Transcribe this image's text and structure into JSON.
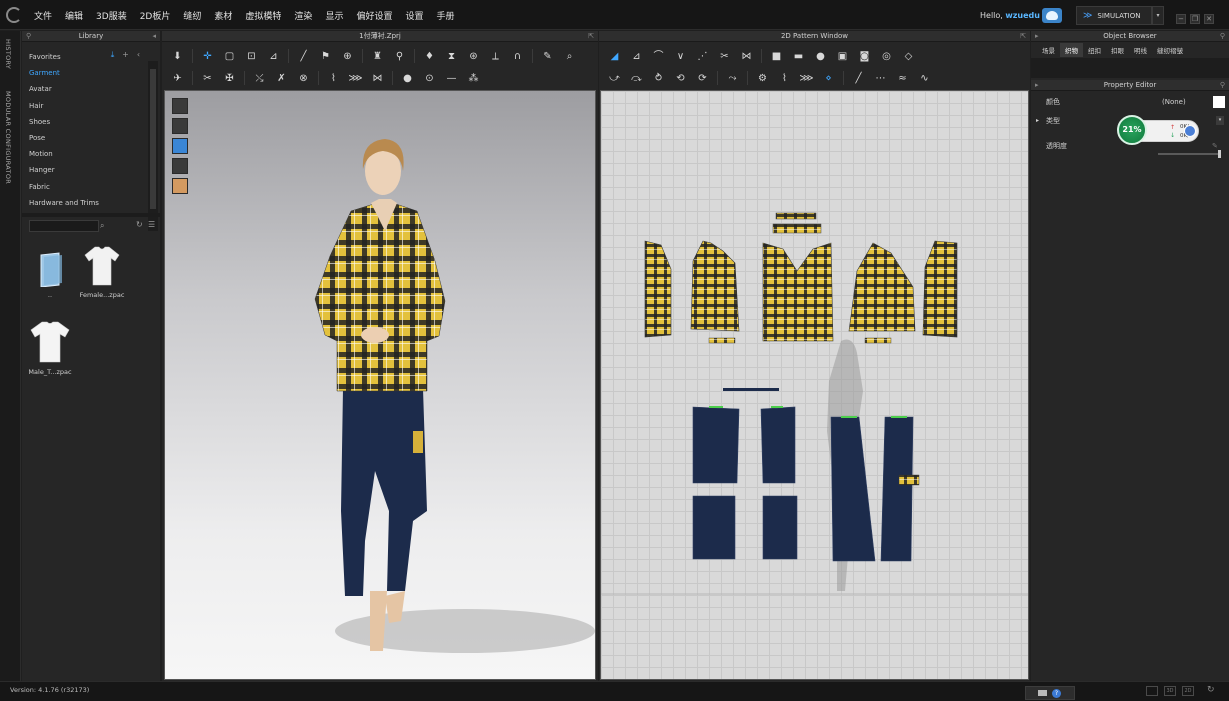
{
  "menu": [
    "文件",
    "编辑",
    "3D服装",
    "2D板片",
    "缝纫",
    "素材",
    "虚拟模特",
    "渲染",
    "显示",
    "偏好设置",
    "设置",
    "手册"
  ],
  "header": {
    "greeting_prefix": "Hello, ",
    "username": "wzuedu",
    "simulation_label": "SIMULATION",
    "sim_icon": "double-chevron-icon",
    "window_controls": [
      "−",
      "❐",
      "✕"
    ]
  },
  "left_strip": {
    "tabs": [
      "HISTORY",
      "MODULAR CONFIGURATOR"
    ]
  },
  "library": {
    "title": "Library",
    "tree": [
      "Favorites",
      "Garment",
      "Avatar",
      "Hair",
      "Shoes",
      "Pose",
      "Motion",
      "Hanger",
      "Fabric",
      "Hardware and Trims"
    ],
    "selected_index": 1,
    "thumbnails": [
      "..",
      "Female...zpac",
      "Male_T...zpac"
    ]
  },
  "window_3d": {
    "title": "1付薄衬.Zprj"
  },
  "window_2d": {
    "title": "2D Pattern Window"
  },
  "object_browser": {
    "title": "Object Browser",
    "tabs": [
      "场景",
      "织物",
      "纽扣",
      "扣眼",
      "明线",
      "缝纫褶皱"
    ],
    "active_tab": 1
  },
  "property_editor": {
    "title": "Property Editor",
    "rows": [
      {
        "label": "颜色",
        "value": "(None)"
      },
      {
        "label": "类型",
        "value": ""
      },
      {
        "label": "透明度",
        "value": ""
      }
    ],
    "opacity_fraction": 1.0
  },
  "perf_widget": {
    "cpu_percent": "21%",
    "upload": "0K/s",
    "download": "0K/s"
  },
  "statusbar": {
    "version": "Version: 4.1.76 (r32173)",
    "view_buttons": [
      "",
      "3D",
      "2D"
    ]
  },
  "colors": {
    "accent": "#3fa7ff",
    "plaid_yellow": "#e3c13c",
    "denim": "#1c2b4b",
    "perf_green": "#169650"
  }
}
